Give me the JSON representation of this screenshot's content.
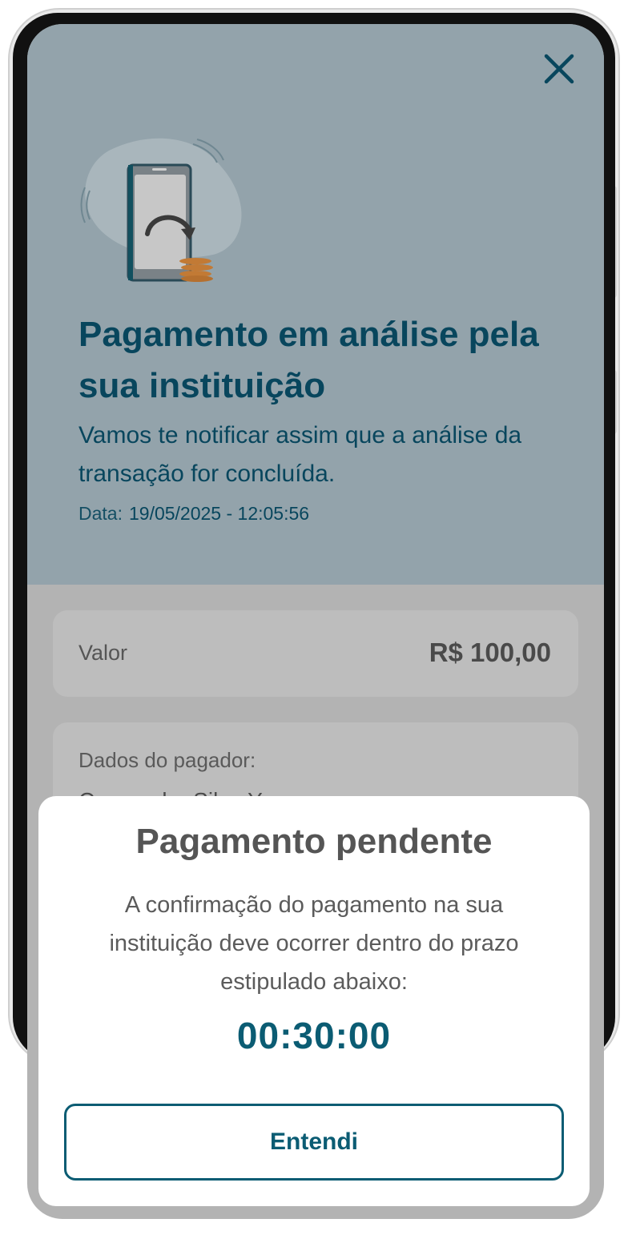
{
  "header": {
    "title": "Pagamento em análise pela sua instituição",
    "subtitle": "Vamos te notificar assim que a análise da transação for concluída.",
    "date_label": "Data:",
    "date_value": "19/05/2025 - 12:05:56",
    "close_icon": "close-icon",
    "illustration": "phone-coins-illustration"
  },
  "summary": {
    "value_label": "Valor",
    "value_amount": "R$ 100,00",
    "payer_label": "Dados do pagador:",
    "payer_name": "Cassandra Silva Y..."
  },
  "modal": {
    "title": "Pagamento pendente",
    "text": "A confirmação do pagamento na sua instituição deve ocorrer dentro do prazo estipulado abaixo:",
    "timer": "00:30:00",
    "button_label": "Entendi"
  },
  "colors": {
    "primary": "#0b5c73",
    "title": "#08465d",
    "header_bg": "#93a3ab",
    "overlay_bg": "#b3b3b3"
  }
}
